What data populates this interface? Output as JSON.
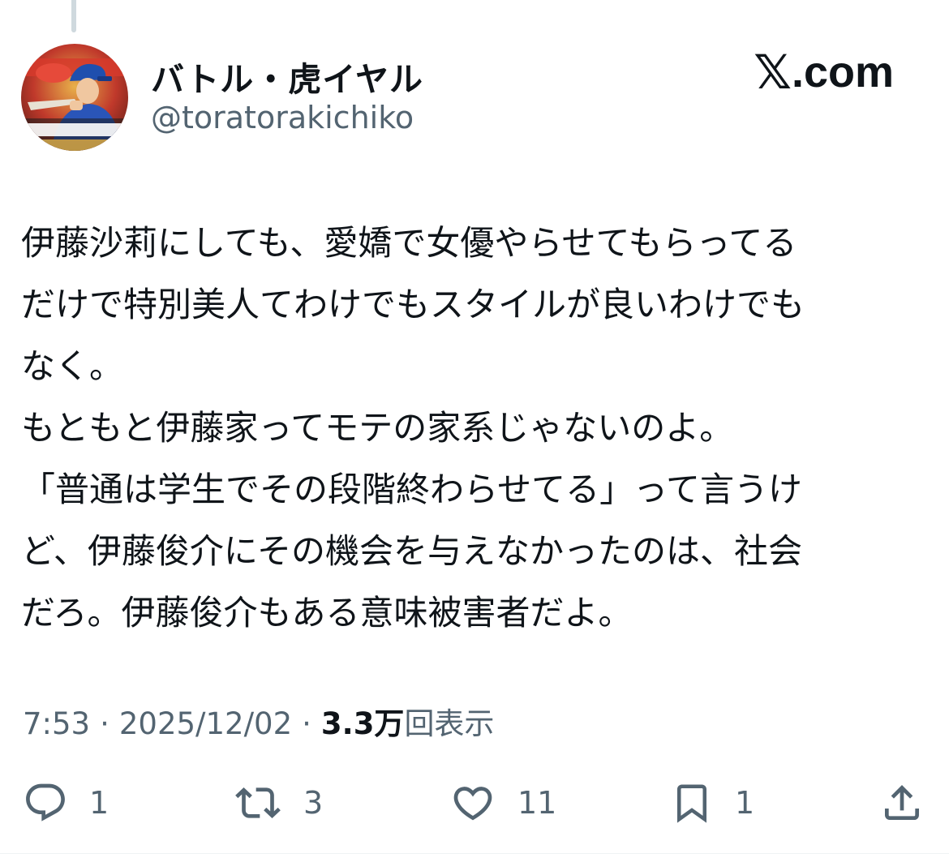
{
  "author": {
    "display_name": "バトル・虎イヤル",
    "handle": "@toratorakichiko",
    "avatar_icon": "avatar-baseball-player-icon"
  },
  "brand": {
    "x_glyph": "𝕏",
    "domain": ".com"
  },
  "tweet": {
    "lines": [
      "伊藤沙莉にしても、愛嬌で女優やらせてもらってる",
      "だけで特別美人てわけでもスタイルが良いわけでも",
      "なく。",
      "もともと伊藤家ってモテの家系じゃないのよ。",
      "「普通は学生でその段階終わらせてる」って言うけ",
      "ど、伊藤俊介にその機会を与えなかったのは、社会",
      "だろ。伊藤俊介もある意味被害者だよ。"
    ]
  },
  "meta": {
    "time": "7:53",
    "separator": "·",
    "date": "2025/12/02",
    "views_count": "3.3万",
    "views_label": "回表示"
  },
  "actions": {
    "reply": {
      "icon": "reply-icon",
      "count": "1"
    },
    "retweet": {
      "icon": "retweet-icon",
      "count": "3"
    },
    "like": {
      "icon": "heart-icon",
      "count": "11"
    },
    "bookmark": {
      "icon": "bookmark-icon",
      "count": "1"
    },
    "share": {
      "icon": "share-icon"
    }
  },
  "colors": {
    "text_primary": "#0f1419",
    "text_secondary": "#536471",
    "thread_line": "#cfd9de"
  }
}
